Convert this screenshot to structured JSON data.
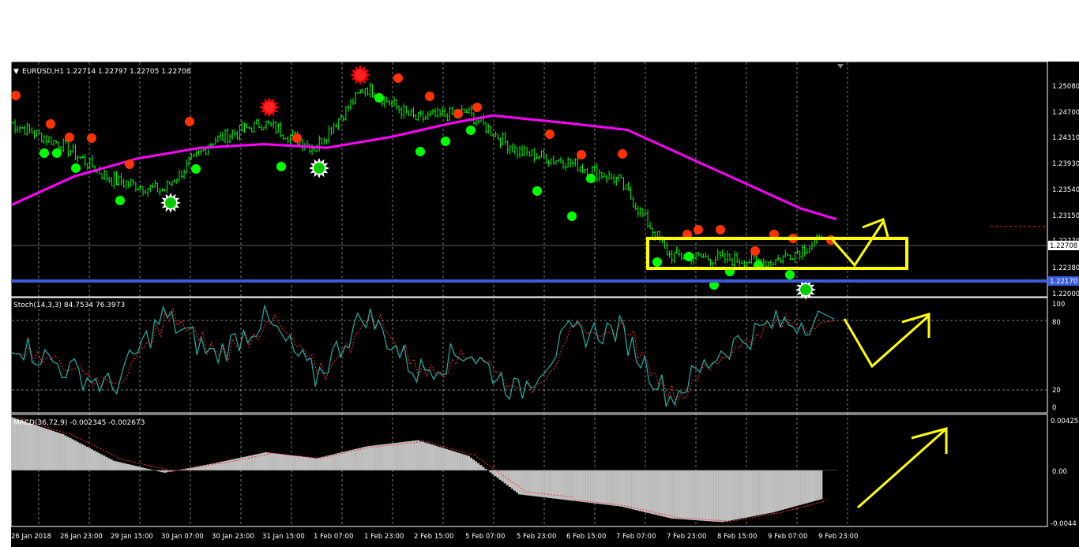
{
  "main": {
    "header": "EURUSD,H1  1.22714 1.22797 1.22705 1.22708",
    "price_axis": [
      "1.25080",
      "1.24700",
      "1.24310",
      "1.23930",
      "1.23540",
      "1.23150",
      "1.22770",
      "1.22380",
      "1.22000"
    ],
    "current_price_tag": "1.22708",
    "support_price_tag": "1.22170"
  },
  "stoch": {
    "header": "Stoch(14,3,3) 84.7534 76.3973",
    "axis": [
      "100",
      "80",
      "20",
      "0"
    ]
  },
  "macd": {
    "header": "MACD(36,72,9) -0.002345 -0.002673",
    "axis": [
      "0.00425",
      "0.00",
      "-0.0044"
    ]
  },
  "time_axis": [
    "26 Jan 2018",
    "26 Jan 23:00",
    "29 Jan 15:00",
    "30 Jan 07:00",
    "30 Jan 23:00",
    "31 Jan 15:00",
    "1 Feb 07:00",
    "1 Feb 23:00",
    "2 Feb 15:00",
    "5 Feb 07:00",
    "5 Feb 23:00",
    "6 Feb 15:00",
    "7 Feb 07:00",
    "7 Feb 23:00",
    "8 Feb 15:00",
    "9 Feb 07:00",
    "9 Feb 23:00"
  ],
  "colors": {
    "background": "#000000",
    "candle": "#00ff00",
    "moving_average": "#ff00ff",
    "support_line": "#3b5bdb",
    "annotation": "#ffff00",
    "stoch_main": "#20b2aa",
    "stoch_signal": "#ff3030",
    "macd_hist": "#c0c0c0"
  },
  "chart_data": [
    {
      "type": "line",
      "x": [
        "26 Jan 2018",
        "26 Jan 23:00",
        "29 Jan 15:00",
        "30 Jan 07:00",
        "30 Jan 23:00",
        "31 Jan 15:00",
        "1 Feb 07:00",
        "1 Feb 23:00",
        "2 Feb 15:00",
        "5 Feb 07:00",
        "5 Feb 23:00",
        "6 Feb 15:00",
        "7 Feb 07:00",
        "7 Feb 23:00",
        "8 Feb 15:00",
        "9 Feb 07:00",
        "9 Feb 23:00"
      ],
      "series": [
        {
          "name": "EURUSD,H1",
          "values": [
            1.244,
            1.241,
            1.236,
            1.2345,
            1.2415,
            1.244,
            1.2405,
            1.249,
            1.2445,
            1.2455,
            1.24,
            1.2385,
            1.236,
            1.2255,
            1.225,
            1.2245,
            1.2275
          ]
        }
      ],
      "ylim": [
        1.22,
        1.252
      ]
    },
    {
      "type": "line",
      "x": [
        "26 Jan 2018",
        "26 Jan 23:00",
        "29 Jan 15:00",
        "30 Jan 07:00",
        "30 Jan 23:00",
        "31 Jan 15:00",
        "1 Feb 07:00",
        "1 Feb 23:00",
        "2 Feb 15:00",
        "5 Feb 07:00",
        "5 Feb 23:00",
        "6 Feb 15:00",
        "7 Feb 07:00",
        "7 Feb 23:00",
        "8 Feb 15:00",
        "9 Feb 07:00",
        "9 Feb 23:00"
      ],
      "series": [
        {
          "name": "Stoch(14,3,3)",
          "values": [
            65,
            40,
            20,
            88,
            50,
            85,
            30,
            90,
            35,
            55,
            15,
            70,
            75,
            10,
            55,
            80,
            84.75
          ]
        }
      ],
      "ylim": [
        0,
        100
      ]
    },
    {
      "type": "bar",
      "x": [
        "26 Jan 2018",
        "26 Jan 23:00",
        "29 Jan 15:00",
        "30 Jan 07:00",
        "30 Jan 23:00",
        "31 Jan 15:00",
        "1 Feb 07:00",
        "1 Feb 23:00",
        "2 Feb 15:00",
        "5 Feb 07:00",
        "5 Feb 23:00",
        "6 Feb 15:00",
        "7 Feb 07:00",
        "7 Feb 23:00",
        "8 Feb 15:00",
        "9 Feb 07:00",
        "9 Feb 23:00"
      ],
      "series": [
        {
          "name": "MACD(36,72,9)",
          "values": [
            0.0044,
            0.003,
            0.0008,
            -0.0002,
            0.0006,
            0.0015,
            0.001,
            0.002,
            0.0025,
            0.0012,
            -0.002,
            -0.0025,
            -0.003,
            -0.004,
            -0.0043,
            -0.0035,
            -0.002345
          ]
        }
      ],
      "ylim": [
        -0.0044,
        0.00425
      ]
    }
  ]
}
